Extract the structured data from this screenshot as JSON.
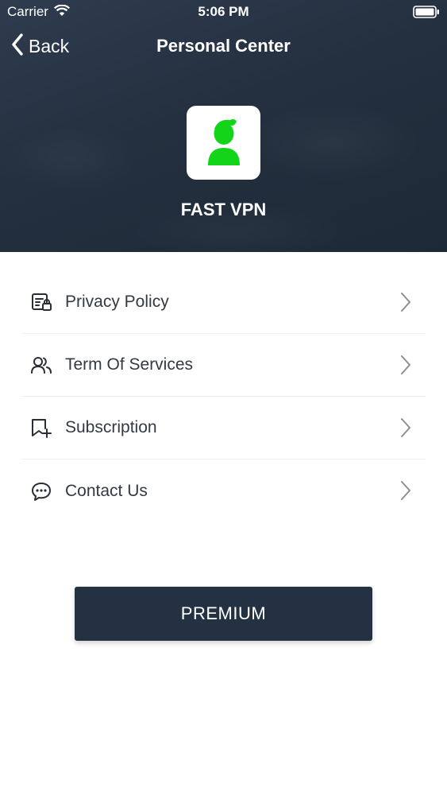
{
  "status_bar": {
    "carrier": "Carrier",
    "time": "5:06 PM"
  },
  "nav": {
    "back_label": "Back",
    "title": "Personal Center"
  },
  "profile": {
    "app_name": "FAST VPN",
    "avatar_color": "#14d41a"
  },
  "menu": {
    "items": [
      {
        "label": "Privacy Policy",
        "icon": "privacy-doc-icon"
      },
      {
        "label": "Term Of Services",
        "icon": "users-icon"
      },
      {
        "label": "Subscription",
        "icon": "bookmark-add-icon"
      },
      {
        "label": "Contact Us",
        "icon": "chat-bubble-icon"
      }
    ]
  },
  "premium": {
    "label": "PREMIUM"
  },
  "colors": {
    "header": "#243142",
    "accent_green": "#14d41a",
    "button": "#243142"
  }
}
